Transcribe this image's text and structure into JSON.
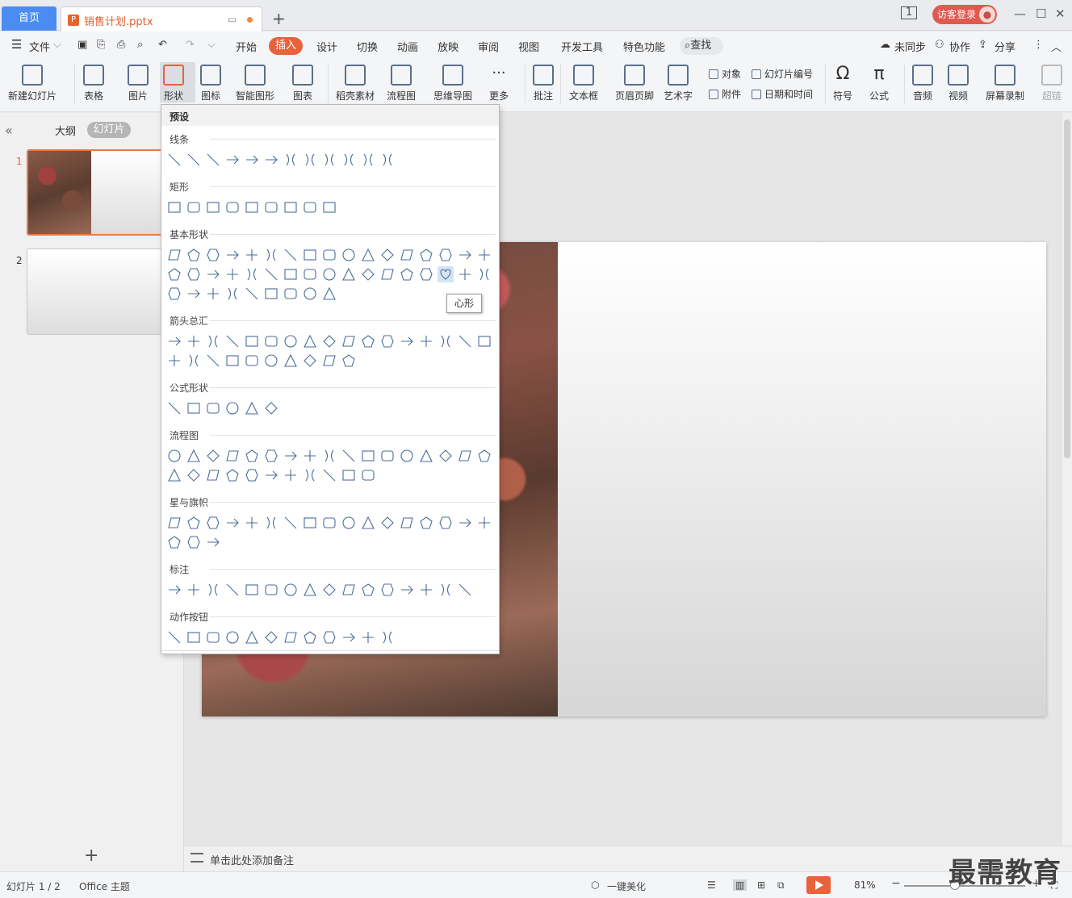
{
  "titlebar": {
    "home_tab": "首页",
    "doc_tab": "销售计划.pptx",
    "login": "访客登录"
  },
  "menubar": {
    "file": "文件",
    "tabs": [
      "开始",
      "插入",
      "设计",
      "切换",
      "动画",
      "放映",
      "审阅",
      "视图",
      "开发工具",
      "特色功能"
    ],
    "active_tab": "插入",
    "search": "查找",
    "sync": "未同步",
    "collab": "协作",
    "share": "分享"
  },
  "ribbon": {
    "new_slide": "新建幻灯片",
    "table": "表格",
    "picture": "图片",
    "shape": "形状",
    "icon": "图标",
    "smartart": "智能图形",
    "chart": "图表",
    "material": "稻壳素材",
    "flowchart": "流程图",
    "mindmap": "思维导图",
    "more": "更多",
    "comment": "批注",
    "textbox": "文本框",
    "header_footer": "页眉页脚",
    "wordart": "艺术字",
    "object": "对象",
    "attachment": "附件",
    "slide_number": "幻灯片编号",
    "datetime": "日期和时间",
    "symbol": "符号",
    "formula": "公式",
    "audio": "音频",
    "video": "视频",
    "screen_record": "屏幕录制",
    "hyperlink": "超链"
  },
  "leftpanel": {
    "outline_tab": "大纲",
    "slides_tab": "幻灯片",
    "slide_numbers": [
      "1",
      "2"
    ]
  },
  "shapes_dropdown": {
    "header": "预设",
    "categories": [
      "线条",
      "矩形",
      "基本形状",
      "箭头总汇",
      "公式形状",
      "流程图",
      "星与旗帜",
      "标注",
      "动作按钮"
    ],
    "tooltip": "心形"
  },
  "notes": {
    "placeholder": "单击此处添加备注"
  },
  "statusbar": {
    "slide_info": "幻灯片 1 / 2",
    "theme": "Office 主题",
    "beautify": "一键美化",
    "zoom": "81%"
  },
  "watermark": "最需教育",
  "colors": {
    "accent": "#e8623c",
    "home_tab": "#4a8cf1",
    "shape_stroke": "#4a6d9a"
  }
}
